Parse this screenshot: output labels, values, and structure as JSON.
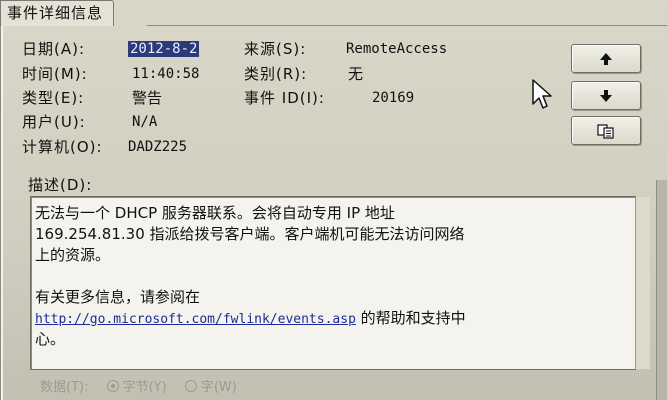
{
  "tab": {
    "label": "事件详细信息"
  },
  "fields": {
    "date": {
      "label": "日期(A):",
      "value": "2012-8-2"
    },
    "time": {
      "label": "时间(M):",
      "value": "11:40:58"
    },
    "type": {
      "label": "类型(E):",
      "value": "警告"
    },
    "user": {
      "label": "用户(U):",
      "value": "N/A"
    },
    "computer": {
      "label": "计算机(O):",
      "value": "DADZ225"
    },
    "source": {
      "label": "来源(S):",
      "value": "RemoteAccess"
    },
    "category": {
      "label": "类别(R):",
      "value": "无"
    },
    "event_id": {
      "label": "事件 ID(I):",
      "value": "20169"
    }
  },
  "description": {
    "label": "描述(D):",
    "lines": [
      "无法与一个 DHCP 服务器联系。会将自动专用 IP 地址",
      "169.254.81.30  指派给拨号客户端。客户端机可能无法访问网络",
      "上的资源。",
      "",
      "有关更多信息，请参阅在"
    ],
    "link": "http://go.microsoft.com/fwlink/events.asp",
    "after_link": " 的帮助和支持中",
    "last_line": "心。"
  },
  "data_section": {
    "label": "数据(T):",
    "option_bytes": "字节(Y)",
    "option_words": "字(W)",
    "selected": "bytes"
  },
  "buttons": {
    "up": "up-arrow-icon",
    "down": "down-arrow-icon",
    "copy": "copy-icon"
  }
}
